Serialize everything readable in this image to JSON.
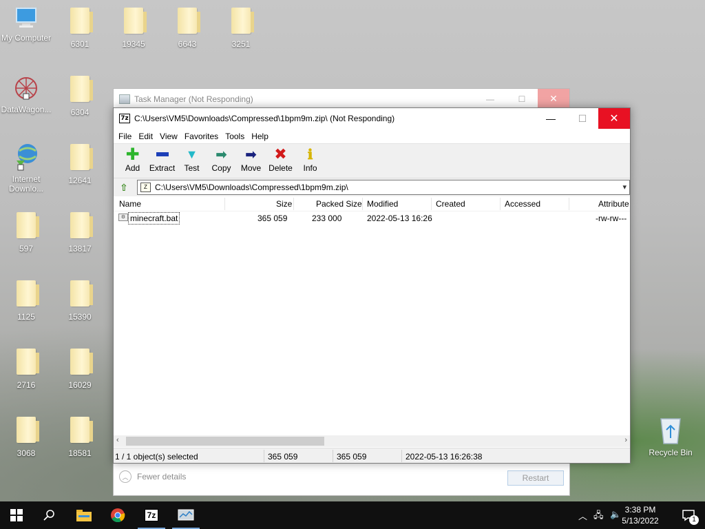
{
  "desktop": {
    "icons": [
      {
        "label": "My Computer"
      },
      {
        "label": "6301"
      },
      {
        "label": "19345"
      },
      {
        "label": "6643"
      },
      {
        "label": "3251"
      },
      {
        "label": "DataWagon..."
      },
      {
        "label": "6304"
      },
      {
        "label": "Internet Downlo..."
      },
      {
        "label": "12641"
      },
      {
        "label": "597"
      },
      {
        "label": "13817"
      },
      {
        "label": "1125"
      },
      {
        "label": "15390"
      },
      {
        "label": "2716"
      },
      {
        "label": "16029"
      },
      {
        "label": "3068"
      },
      {
        "label": "18581"
      },
      {
        "label": "Recycle Bin"
      }
    ]
  },
  "task_manager": {
    "title": "Task Manager (Not Responding)",
    "fewer_details": "Fewer details",
    "restart": "Restart"
  },
  "zip_window": {
    "title": "C:\\Users\\VM5\\Downloads\\Compressed\\1bpm9m.zip\\ (Not Responding)",
    "menu": [
      "File",
      "Edit",
      "View",
      "Favorites",
      "Tools",
      "Help"
    ],
    "toolbar": [
      {
        "label": "Add",
        "icon": "add-icon",
        "color": "#2db52d"
      },
      {
        "label": "Extract",
        "icon": "extract-icon",
        "color": "#1d3fb8"
      },
      {
        "label": "Test",
        "icon": "test-icon",
        "color": "#23b9c9"
      },
      {
        "label": "Copy",
        "icon": "copy-icon",
        "color": "#2b8a6e"
      },
      {
        "label": "Move",
        "icon": "move-icon",
        "color": "#1a237e"
      },
      {
        "label": "Delete",
        "icon": "delete-icon",
        "color": "#d21a1a"
      },
      {
        "label": "Info",
        "icon": "info-icon",
        "color": "#d6b400"
      }
    ],
    "address": "C:\\Users\\VM5\\Downloads\\Compressed\\1bpm9m.zip\\",
    "columns": [
      "Name",
      "Size",
      "Packed Size",
      "Modified",
      "Created",
      "Accessed",
      "Attribute"
    ],
    "rows": [
      {
        "name": "minecraft.bat",
        "size": "365 059",
        "packed": "233 000",
        "modified": "2022-05-13 16:26",
        "created": "",
        "accessed": "",
        "attributes": "-rw-rw---"
      }
    ],
    "status": {
      "selected": "1 / 1 object(s) selected",
      "size": "365 059",
      "packed": "365 059",
      "modified": "2022-05-13 16:26:38"
    }
  },
  "taskbar": {
    "time": "3:38 PM",
    "date": "5/13/2022",
    "notification_count": "1",
    "sevenzip_label": "7z"
  }
}
